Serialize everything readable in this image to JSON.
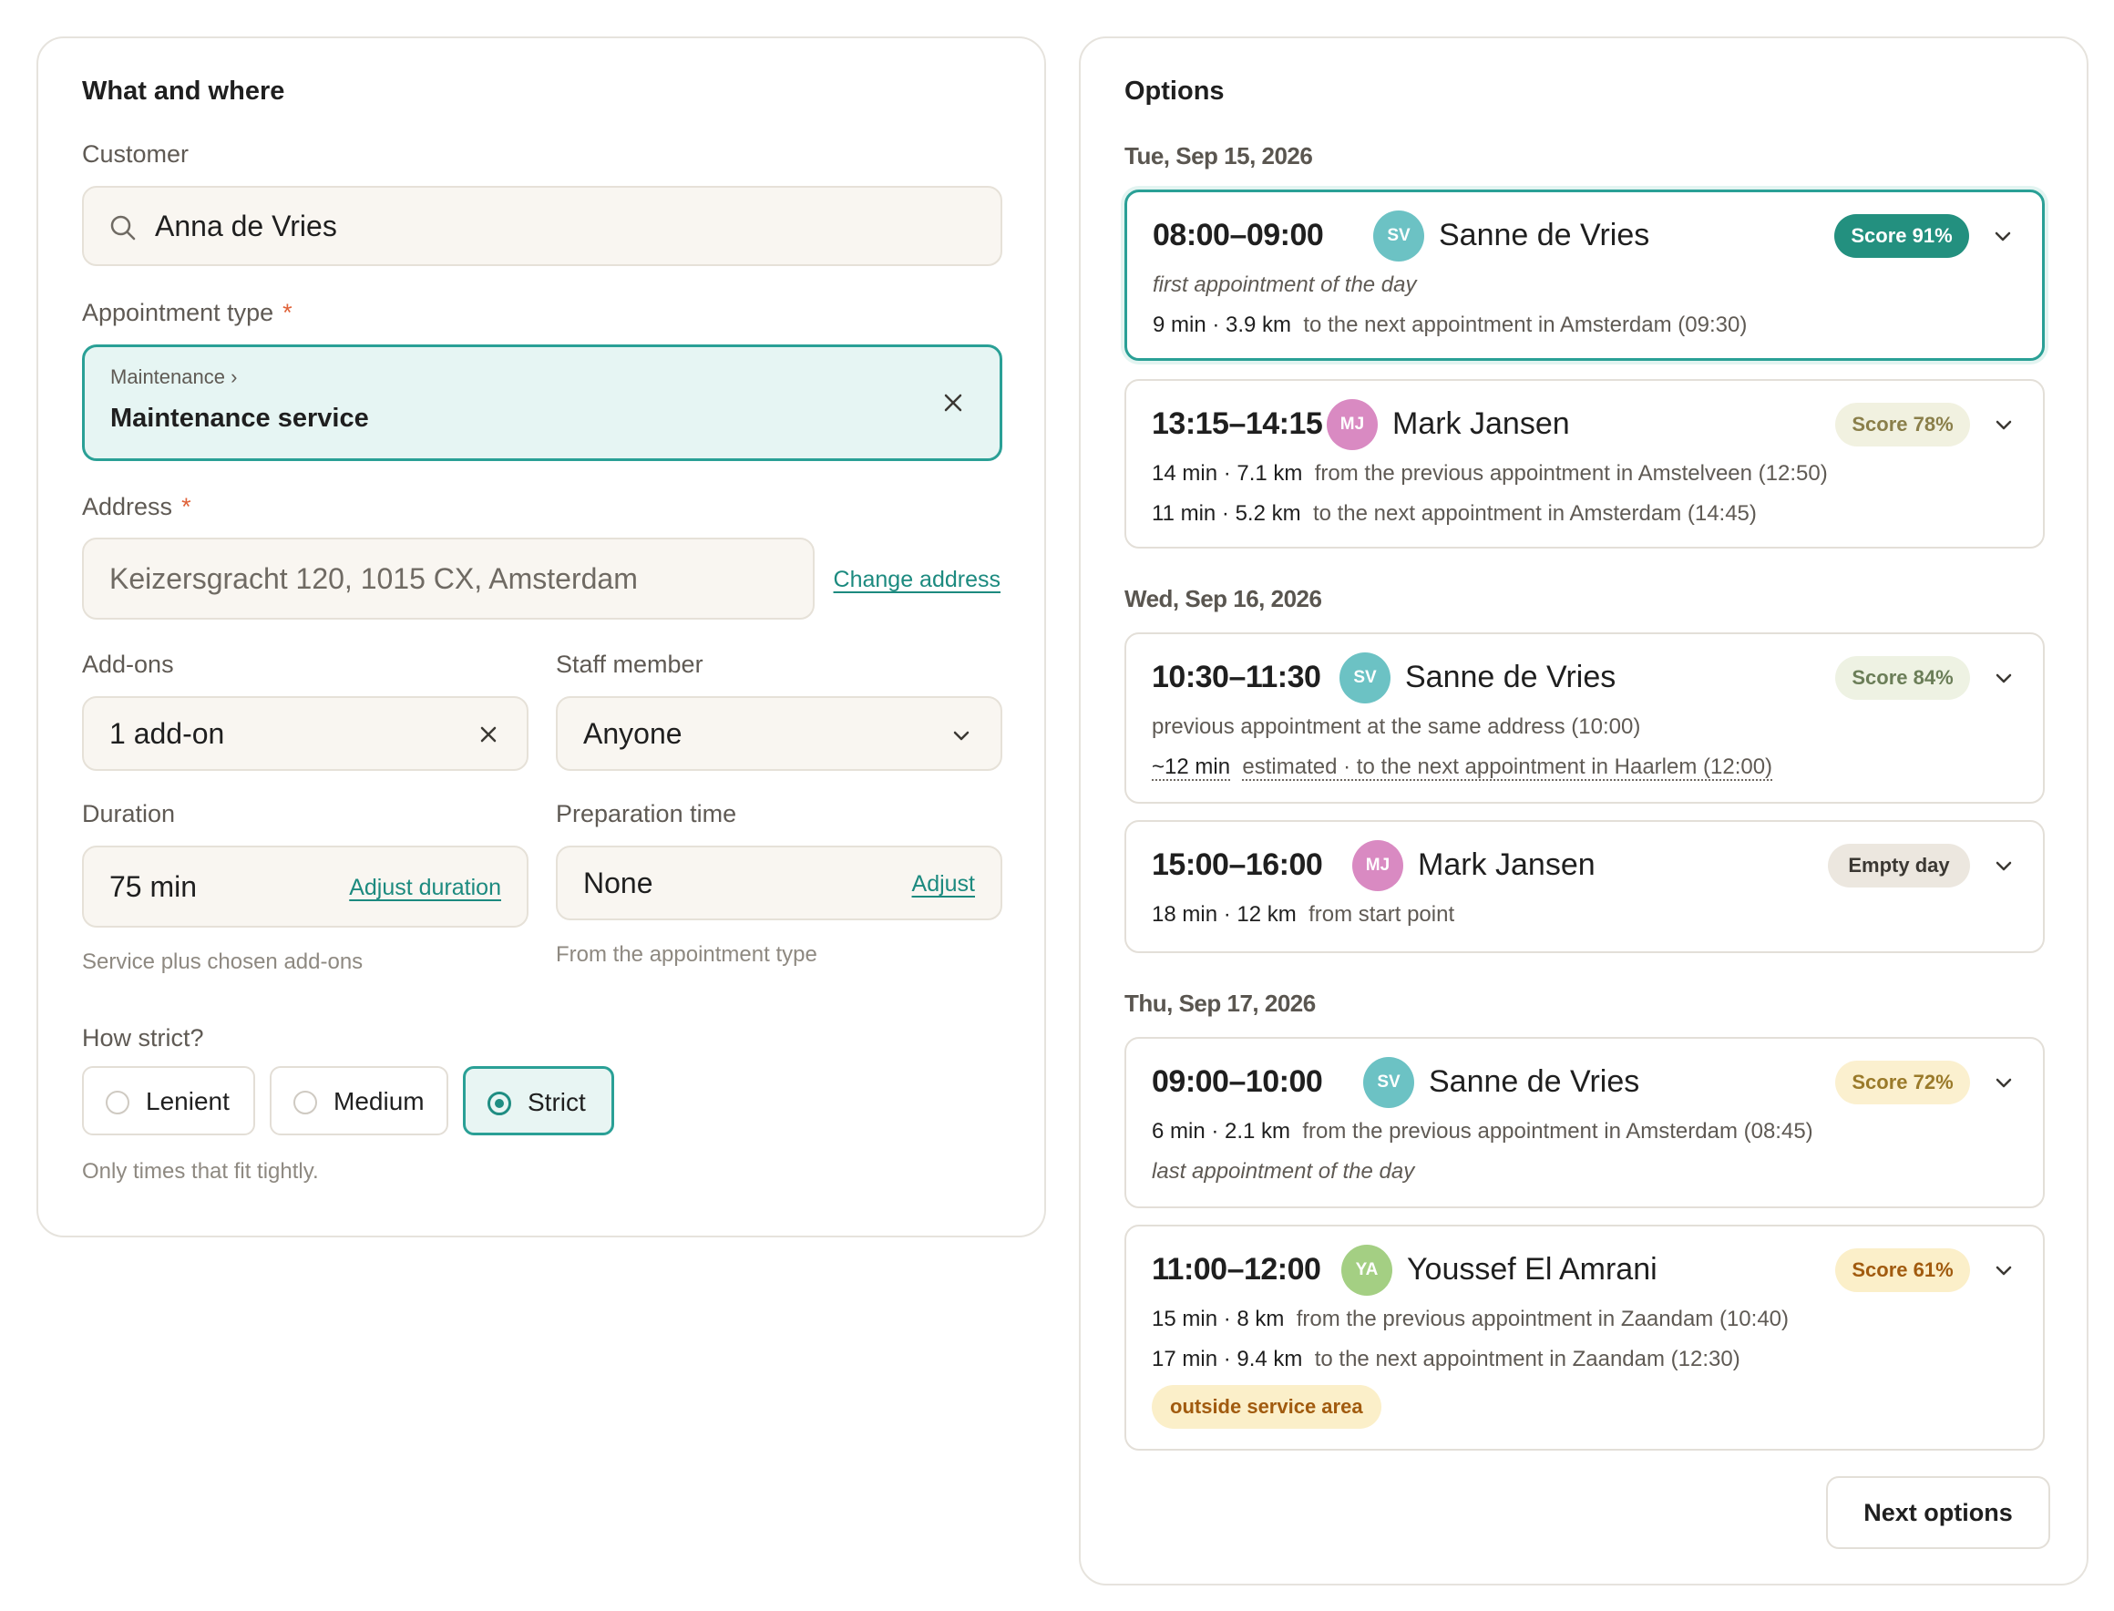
{
  "left": {
    "title": "What and where",
    "customer": {
      "label": "Customer",
      "value": "Anna de Vries"
    },
    "appointment_type": {
      "label": "Appointment type",
      "required_mark": "*",
      "breadcrumb": "Maintenance ›",
      "value": "Maintenance service"
    },
    "address": {
      "label": "Address",
      "required_mark": "*",
      "value": "Keizersgracht 120, 1015 CX, Amsterdam",
      "change_link": "Change address"
    },
    "addons": {
      "label": "Add-ons",
      "value": "1 add-on"
    },
    "staff": {
      "label": "Staff member",
      "value": "Anyone"
    },
    "duration": {
      "label": "Duration",
      "value": "75 min",
      "link": "Adjust duration",
      "helper": "Service plus chosen add-ons"
    },
    "prep": {
      "label": "Preparation time",
      "value": "None",
      "link": "Adjust",
      "helper": "From the appointment type"
    },
    "strictness": {
      "label": "How strict?",
      "options": [
        "Lenient",
        "Medium",
        "Strict"
      ],
      "selected": "Strict",
      "helper": "Only times that fit tightly."
    }
  },
  "right": {
    "title": "Options",
    "days": [
      {
        "date": "Tue, Sep 15, 2026",
        "slots": [
          {
            "time": "08:00–09:00",
            "initials": "SV",
            "name": "Sanne de Vries",
            "badge": "Score 91%",
            "note": "first appointment of the day",
            "line1_strong": "9 min · 3.9 km",
            "line1_rest": "to the next appointment in Amsterdam (09:30)"
          },
          {
            "time": "13:15–14:15",
            "initials": "MJ",
            "name": "Mark Jansen",
            "badge": "Score 78%",
            "line1_strong": "14 min · 7.1 km",
            "line1_rest": "from the previous appointment in Amstelveen (12:50)",
            "line2_strong": "11 min · 5.2 km",
            "line2_rest": "to the next appointment in Amsterdam (14:45)"
          }
        ]
      },
      {
        "date": "Wed, Sep 16, 2026",
        "slots": [
          {
            "time": "10:30–11:30",
            "initials": "SV",
            "name": "Sanne de Vries",
            "badge": "Score 84%",
            "line1_rest": "previous appointment at the same address (10:00)",
            "line2_strong": "~12 min",
            "line2_est": "estimated · to the next appointment in Haarlem (12:00)"
          },
          {
            "time": "15:00–16:00",
            "initials": "MJ",
            "name": "Mark Jansen",
            "badge": "Empty day",
            "line1_strong": "18 min · 12 km",
            "line1_rest": "from start point"
          }
        ]
      },
      {
        "date": "Thu, Sep 17, 2026",
        "slots": [
          {
            "time": "09:00–10:00",
            "initials": "SV",
            "name": "Sanne de Vries",
            "badge": "Score 72%",
            "line1_strong": "6 min · 2.1 km",
            "line1_rest": "from the previous appointment in Amsterdam (08:45)",
            "note": "last appointment of the day"
          },
          {
            "time": "11:00–12:00",
            "initials": "YA",
            "name": "Youssef El Amrani",
            "badge": "Score 61%",
            "line1_strong": "15 min · 8 km",
            "line1_rest": "from the previous appointment in Zaandam (10:40)",
            "line2_strong": "17 min · 9.4 km",
            "line2_rest": "to the next appointment in Zaandam (12:30)",
            "warning": "outside service area"
          }
        ]
      }
    ],
    "next_button": "Next options"
  },
  "colors": {
    "accent": "#2aa096",
    "accent_dark": "#1f8d82",
    "avatar_sv": "#6cc2c4",
    "avatar_mj": "#d98ac2",
    "avatar_ya": "#a4cf83",
    "badge_top": "#23907f",
    "badge_green_bg": "#eef2e3",
    "badge_yellow_bg": "#fbf0cf",
    "badge_gray_bg": "#ece7df"
  }
}
